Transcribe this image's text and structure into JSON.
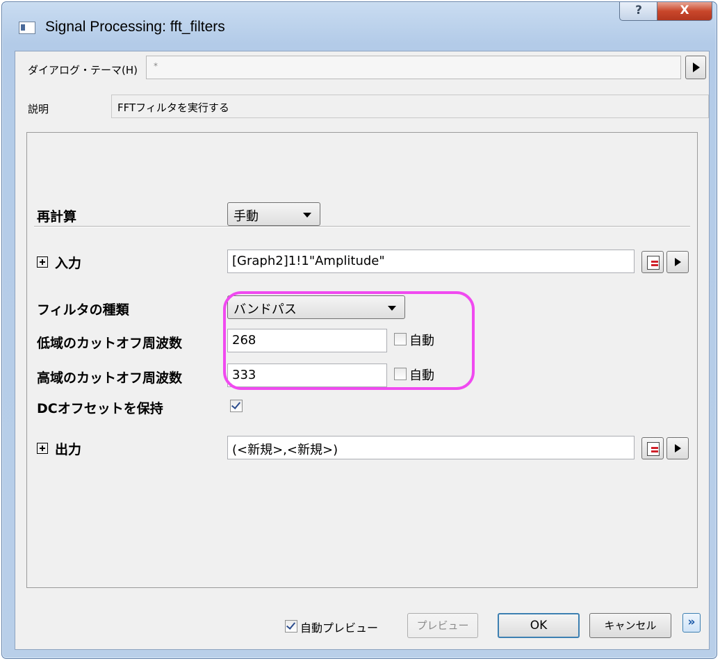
{
  "window": {
    "title": "Signal Processing: fft_filters",
    "help_label": "?",
    "close_label": "X"
  },
  "theme": {
    "label": "ダイアログ・テーマ(H)",
    "value": "*"
  },
  "description": {
    "label": "説明",
    "value": "FFTフィルタを実行する"
  },
  "recalc": {
    "label": "再計算",
    "value": "手動"
  },
  "input": {
    "label": "入力",
    "value": "[Graph2]1!1\"Amplitude\""
  },
  "filter_type": {
    "label": "フィルタの種類",
    "value": "バンドパス"
  },
  "low_cutoff": {
    "label": "低域のカットオフ周波数",
    "value": "268",
    "auto_label": "自動",
    "auto_checked": false
  },
  "high_cutoff": {
    "label": "高域のカットオフ周波数",
    "value": "333",
    "auto_label": "自動",
    "auto_checked": false
  },
  "dc_offset": {
    "label": "DCオフセットを保持",
    "checked": true
  },
  "output": {
    "label": "出力",
    "value": "(<新規>,<新規>)"
  },
  "footer": {
    "auto_preview_label": "自動プレビュー",
    "auto_preview_checked": true,
    "preview_label": "プレビュー",
    "ok_label": "OK",
    "cancel_label": "キャンセル",
    "expand_label": "»"
  },
  "colors": {
    "highlight": "#f04af0",
    "titlebar": "#b9cfe9",
    "close_button": "#c9472b"
  }
}
